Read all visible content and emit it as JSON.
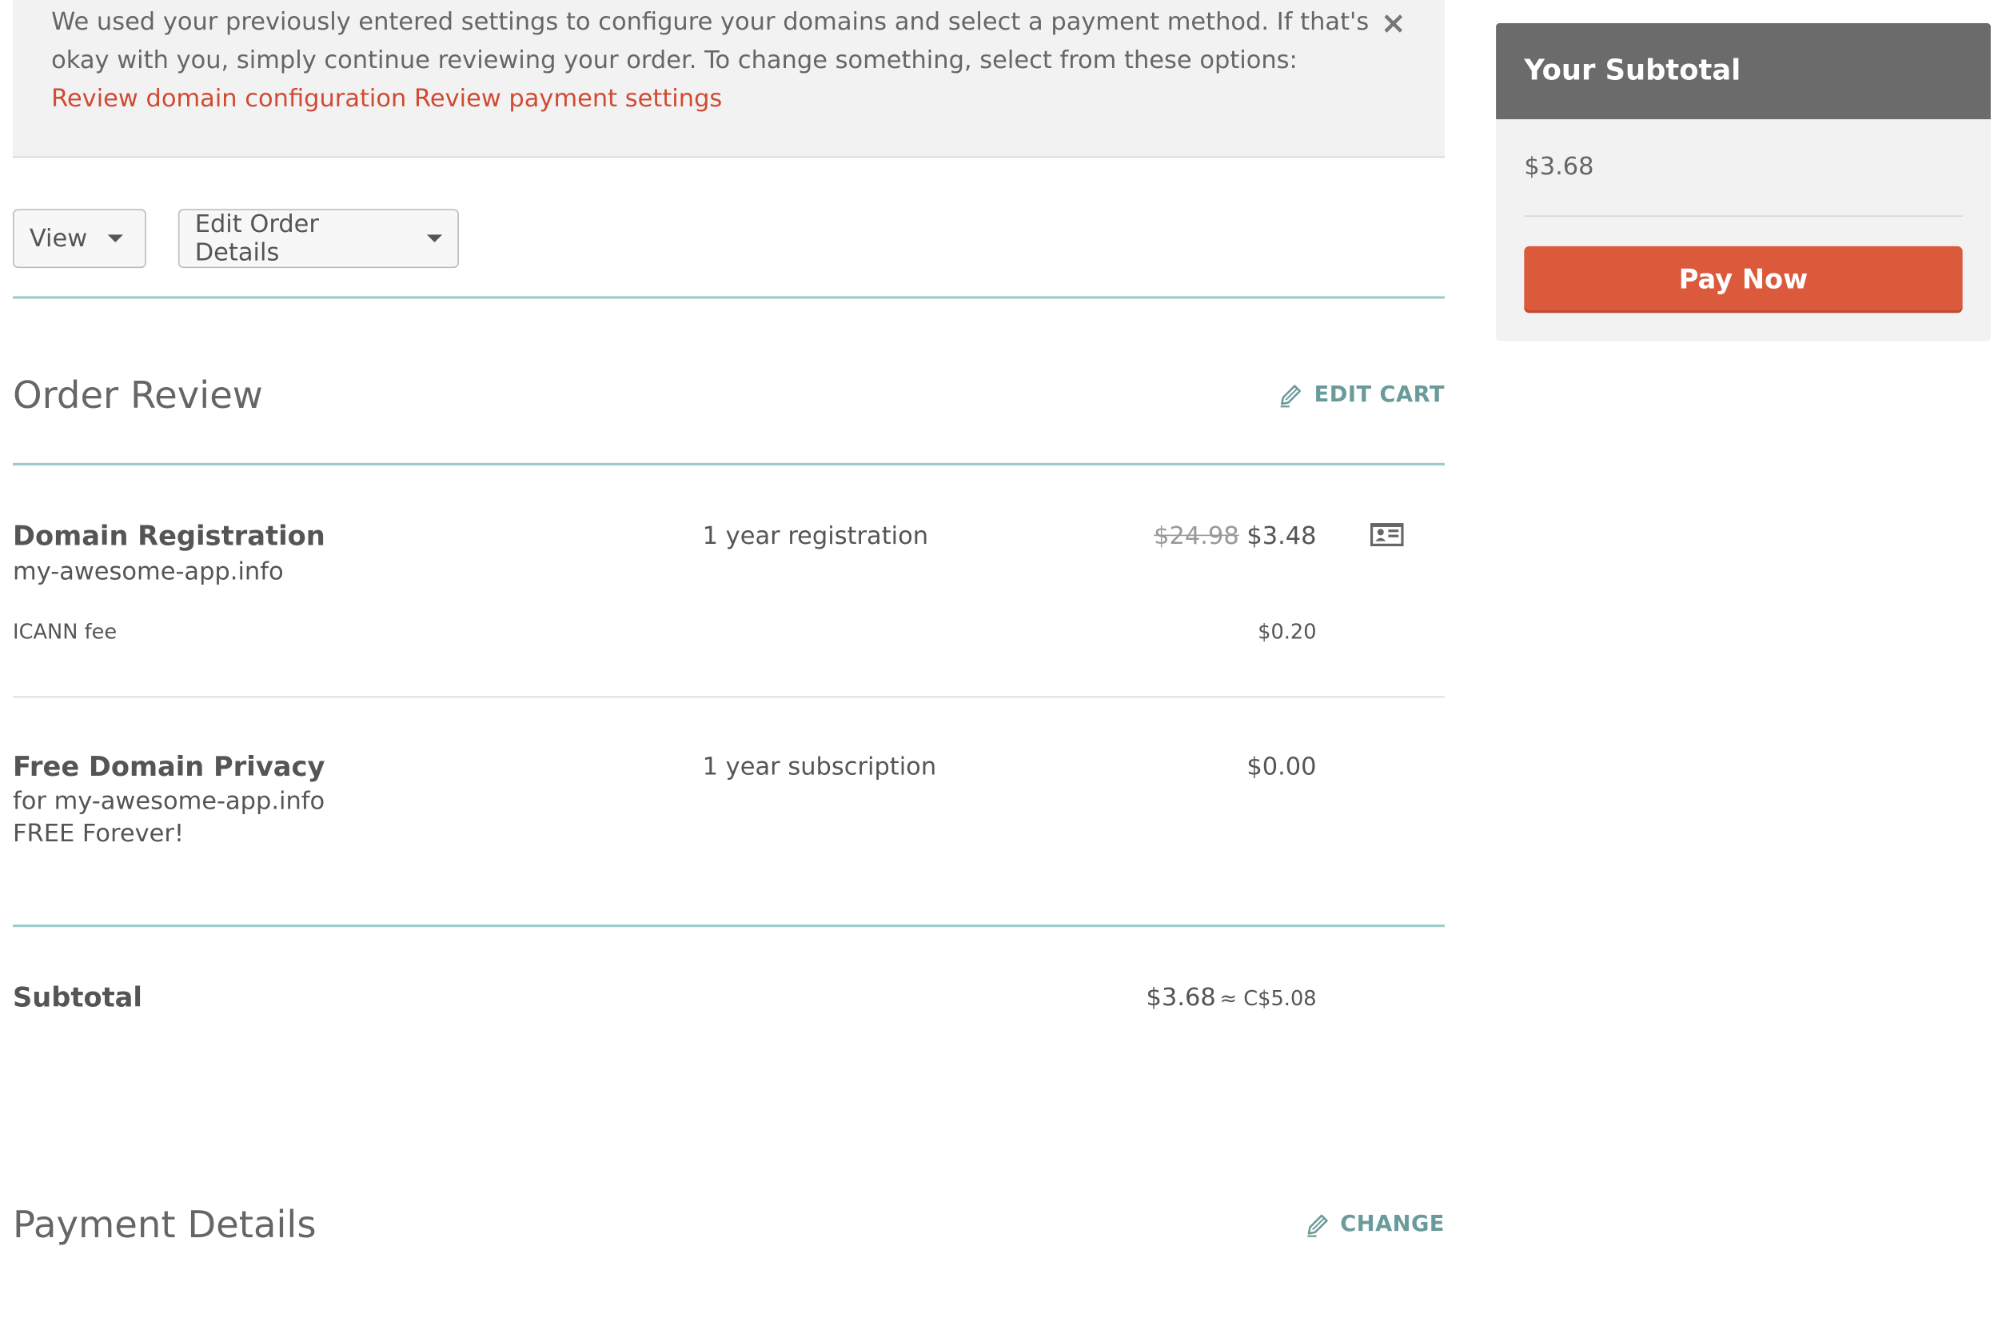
{
  "notice": {
    "text": "We used your previously entered settings to configure your domains and select a payment method. If that's okay with you, simply continue reviewing your order. To change something, select from these options:",
    "link_domain": "Review domain configuration",
    "link_payment": "Review payment settings",
    "close_icon": "×"
  },
  "toolbar": {
    "view_label": "View",
    "edit_order_label": "Edit Order Details"
  },
  "order_review": {
    "title": "Order Review",
    "edit_cart_label": "EDIT CART"
  },
  "items": [
    {
      "name": "Domain Registration",
      "domain": "my-awesome-app.info",
      "term": "1 year registration",
      "original_price": "$24.98",
      "price": "$3.48",
      "fee_label": "ICANN fee",
      "fee_price": "$0.20",
      "icon": "contact-card-icon"
    },
    {
      "name": "Free Domain Privacy",
      "domain": "for my-awesome-app.info",
      "note": "FREE Forever!",
      "term": "1 year subscription",
      "price": "$0.00"
    }
  ],
  "subtotal": {
    "label": "Subtotal",
    "value": "$3.68",
    "approx": "≈ C$5.08"
  },
  "payment_details": {
    "title": "Payment Details",
    "change_label": "CHANGE"
  },
  "sidebar": {
    "header": "Your Subtotal",
    "amount": "$3.68",
    "pay_now_label": "Pay Now"
  },
  "colors": {
    "accent_link": "#d14a33",
    "teal_rule": "#9fcbcb",
    "teal_link": "#6a9a9a",
    "pay_button": "#dc5a3c",
    "sidebar_header": "#6b6b6b"
  }
}
